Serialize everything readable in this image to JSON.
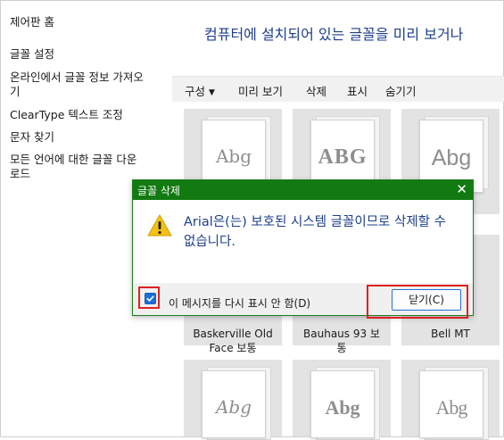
{
  "left_pane": {
    "items": [
      {
        "label": "제어판 홈"
      },
      {
        "label": "글꼴 설정"
      },
      {
        "label_line1": "온라인에서 글꼴 정보 가져오",
        "label_line2": "기"
      },
      {
        "label": "ClearType 텍스트 조정"
      },
      {
        "label": "문자 찾기"
      },
      {
        "label_line1": "모든 언어에 대한 글꼴 다운",
        "label_line2": "로드"
      }
    ]
  },
  "main": {
    "title": "컴퓨터에 설치되어 있는 글꼴을 미리 보거나",
    "toolbar": {
      "organize": "구성",
      "preview": "미리 보기",
      "delete": "삭제",
      "show": "표시",
      "hide": "숨기기"
    },
    "tiles": [
      {
        "sample": "Abg",
        "name_line1": "",
        "name_line2": ""
      },
      {
        "sample": "ABG",
        "name_line1": "",
        "name_line2": ""
      },
      {
        "sample": "Abg",
        "name_line1": "",
        "name_line2": ""
      },
      {
        "sample": "",
        "name_line1": "Baskerville Old",
        "name_line2": "Face 보통"
      },
      {
        "sample": "",
        "name_line1": "Bauhaus 93 보",
        "name_line2": "통"
      },
      {
        "sample": "",
        "name_line1": "Bell MT",
        "name_line2": ""
      },
      {
        "sample": "Abg",
        "name_line1": "",
        "name_line2": ""
      },
      {
        "sample": "Abg",
        "name_line1": "",
        "name_line2": ""
      },
      {
        "sample": "Abg",
        "name_line1": "",
        "name_line2": ""
      }
    ]
  },
  "dialog": {
    "title": "글꼴 삭제",
    "close_glyph": "✕",
    "message": "Arial은(는) 보호된 시스템 글꼴이므로 삭제할 수 없습니다.",
    "checkbox_label": "이 메시지를 다시 표시 안 함(D)",
    "checkbox_checked": true,
    "close_button": "닫기(C)",
    "icon": "warning-icon"
  },
  "colors": {
    "title_blue": "#1e3f8a",
    "dialog_titlebar": "#117a11",
    "highlight_red": "#e02020",
    "checkbox_blue": "#1a6fd6"
  }
}
